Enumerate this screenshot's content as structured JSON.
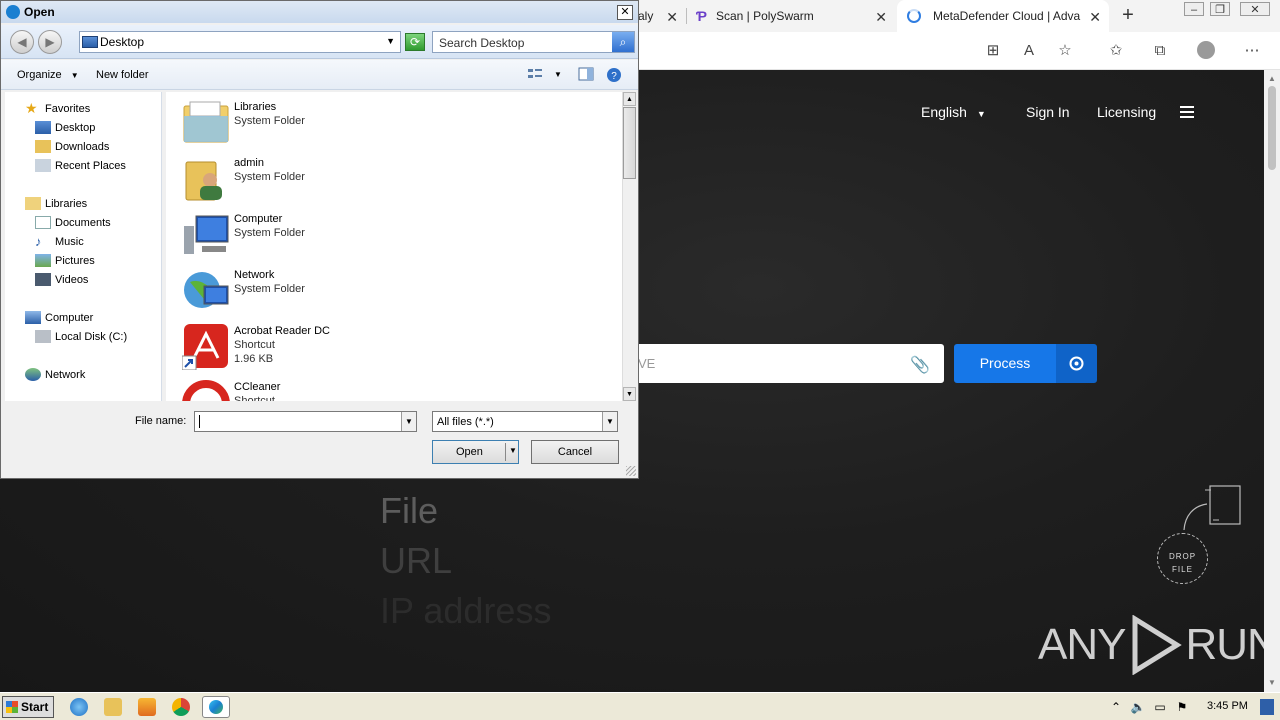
{
  "browser": {
    "tabs": [
      {
        "title": "aly",
        "active": false
      },
      {
        "title": "Scan | PolySwarm",
        "active": false
      },
      {
        "title": "MetaDefender Cloud | Adva",
        "active": true
      }
    ],
    "page": {
      "nav": {
        "language": "English",
        "sign_in": "Sign In",
        "licensing": "Licensing"
      },
      "search_placeholder": "VE",
      "process_label": "Process",
      "keywords": [
        "File",
        "URL",
        "IP address"
      ],
      "drop_label_1": "DROP",
      "drop_label_2": "FILE",
      "watermark": "ANY RUN"
    }
  },
  "dialog": {
    "title": "Open",
    "address": "Desktop",
    "search_placeholder": "Search Desktop",
    "organize": "Organize",
    "new_folder": "New folder",
    "nav": {
      "favorites": "Favorites",
      "desktop": "Desktop",
      "downloads": "Downloads",
      "recent": "Recent Places",
      "libraries": "Libraries",
      "documents": "Documents",
      "music": "Music",
      "pictures": "Pictures",
      "videos": "Videos",
      "computer": "Computer",
      "local_disk": "Local Disk (C:)",
      "network": "Network"
    },
    "files": [
      {
        "name": "Libraries",
        "type": "System Folder",
        "size": ""
      },
      {
        "name": "admin",
        "type": "System Folder",
        "size": ""
      },
      {
        "name": "Computer",
        "type": "System Folder",
        "size": ""
      },
      {
        "name": "Network",
        "type": "System Folder",
        "size": ""
      },
      {
        "name": "Acrobat Reader DC",
        "type": "Shortcut",
        "size": "1.96 KB"
      },
      {
        "name": "CCleaner",
        "type": "Shortcut",
        "size": ""
      }
    ],
    "file_name_label": "File name:",
    "file_name_value": "",
    "filter": "All files (*.*)",
    "open_label": "Open",
    "cancel_label": "Cancel"
  },
  "taskbar": {
    "start": "Start",
    "clock": "3:45 PM"
  }
}
